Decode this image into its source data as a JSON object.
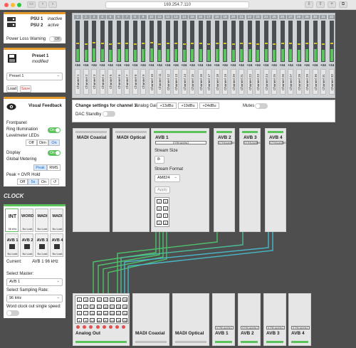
{
  "browser": {
    "url": "169.254.7.110",
    "colors": {
      "close": "#ff5f57",
      "min": "#febc2e",
      "max": "#28c840"
    }
  },
  "psu": {
    "psu1_label": "PSU 1",
    "psu1_state": "inactive",
    "psu2_label": "PSU 2",
    "psu2_state": "active",
    "power_loss_label": "Power Loss Warning",
    "power_loss_toggle": "Off"
  },
  "preset": {
    "title": "Preset 1",
    "state": "modified",
    "select_value": "Preset 1",
    "load": "Load",
    "save": "Save"
  },
  "visual": {
    "title": "Visual Feedback",
    "frontpanel": "Frontpanel",
    "ring_label": "Ring Illumination",
    "ring_toggle": "On",
    "level_label": "Levelmeter LEDs",
    "level_opts": [
      "Off",
      "Dim",
      "On"
    ],
    "display_label": "Display",
    "display_toggle": "On",
    "metering_label": "Global Metering",
    "metering_opts": [
      "Peak",
      "RMS"
    ],
    "hold_label": "Peak + OVR Hold",
    "hold_opts": [
      "Off",
      "5s",
      "On"
    ]
  },
  "clock": {
    "heading": "CLOCK",
    "sources": [
      {
        "label": "INT",
        "sub": "96 kHz"
      },
      {
        "label": "WORD",
        "sub": "No Lock"
      },
      {
        "label": "MADI",
        "sub": "No Lock"
      },
      {
        "label": "MADI",
        "sub": "No Lock"
      }
    ],
    "avb": [
      {
        "label": "AVB 1",
        "sub": "No Lock"
      },
      {
        "label": "AVB 2",
        "sub": "No Lock"
      },
      {
        "label": "AVB 3",
        "sub": "No Lock"
      },
      {
        "label": "AVB 4",
        "sub": "No Lock"
      }
    ],
    "current_label": "Current:",
    "current_value": "AVB 1  96 kHz",
    "master_label": "Select Master:",
    "master_value": "AVB 1",
    "rate_label": "Select Sampling Rate:",
    "rate_value": "96 kHz",
    "wc_label": "Word clock out single speed:"
  },
  "channels": {
    "numbers": [
      "1",
      "2",
      "3",
      "4",
      "5",
      "6",
      "7",
      "8",
      "9",
      "10",
      "11",
      "12",
      "13",
      "14",
      "15",
      "16",
      "17",
      "18",
      "19",
      "20",
      "21",
      "22",
      "23",
      "24",
      "25",
      "26",
      "27",
      "28",
      "29",
      "30",
      "31",
      "32"
    ],
    "gain": "+24",
    "name_prefix": "Channel",
    "levels": [
      0.3,
      0.28,
      0.32,
      0.3,
      0.29,
      0.31,
      0.3,
      0.28,
      0.3,
      0.32,
      0.29,
      0.3,
      0.31,
      0.28,
      0.3,
      0.3,
      0.29,
      0.31,
      0.3,
      0.28,
      0.3,
      0.31,
      0.29,
      0.3,
      0.28,
      0.3,
      0.31,
      0.29,
      0.3,
      0.3,
      0.28,
      0.3
    ]
  },
  "settings": {
    "label": "Change settings for channel 1:",
    "gain_label": "Analog Gain",
    "gain_opts": [
      "+13dBu",
      "+19dBu",
      "+24dBu"
    ],
    "mutes": "Mutes",
    "standby": "DAC Standby"
  },
  "sources_top": [
    {
      "title": "MADI Coaxial",
      "active": false
    },
    {
      "title": "MADI Optical",
      "active": false
    },
    {
      "title": "AVB 1",
      "active": true
    },
    {
      "title": "AVB 2",
      "active": true
    },
    {
      "title": "AVB 3",
      "active": true
    },
    {
      "title": "AVB 4",
      "active": true
    }
  ],
  "streaming": "STREAMING",
  "avb1": {
    "stream_size_label": "Stream Size",
    "stream_size": "8",
    "stream_format_label": "Stream Format",
    "stream_format": "AM824",
    "apply": "Apply",
    "ports": [
      "1",
      "5",
      "2",
      "6",
      "3",
      "7",
      "4",
      "8"
    ]
  },
  "dest": {
    "analog_title": "Analog Out",
    "ports": [
      "1",
      "5",
      "9",
      "13",
      "17",
      "21",
      "25",
      "29",
      "2",
      "6",
      "10",
      "14",
      "18",
      "22",
      "26",
      "30",
      "3",
      "7",
      "11",
      "15",
      "19",
      "23",
      "27",
      "31",
      "4",
      "8",
      "12",
      "16",
      "20",
      "24",
      "28",
      "32"
    ],
    "bottom_cards": [
      {
        "title": "MADI Coaxial",
        "active": false
      },
      {
        "title": "MADI Optical",
        "active": false
      },
      {
        "title": "AVB 1",
        "active": true
      },
      {
        "title": "AVB 2",
        "active": true
      },
      {
        "title": "AVB 3",
        "active": true
      },
      {
        "title": "AVB 4",
        "active": true
      }
    ]
  }
}
